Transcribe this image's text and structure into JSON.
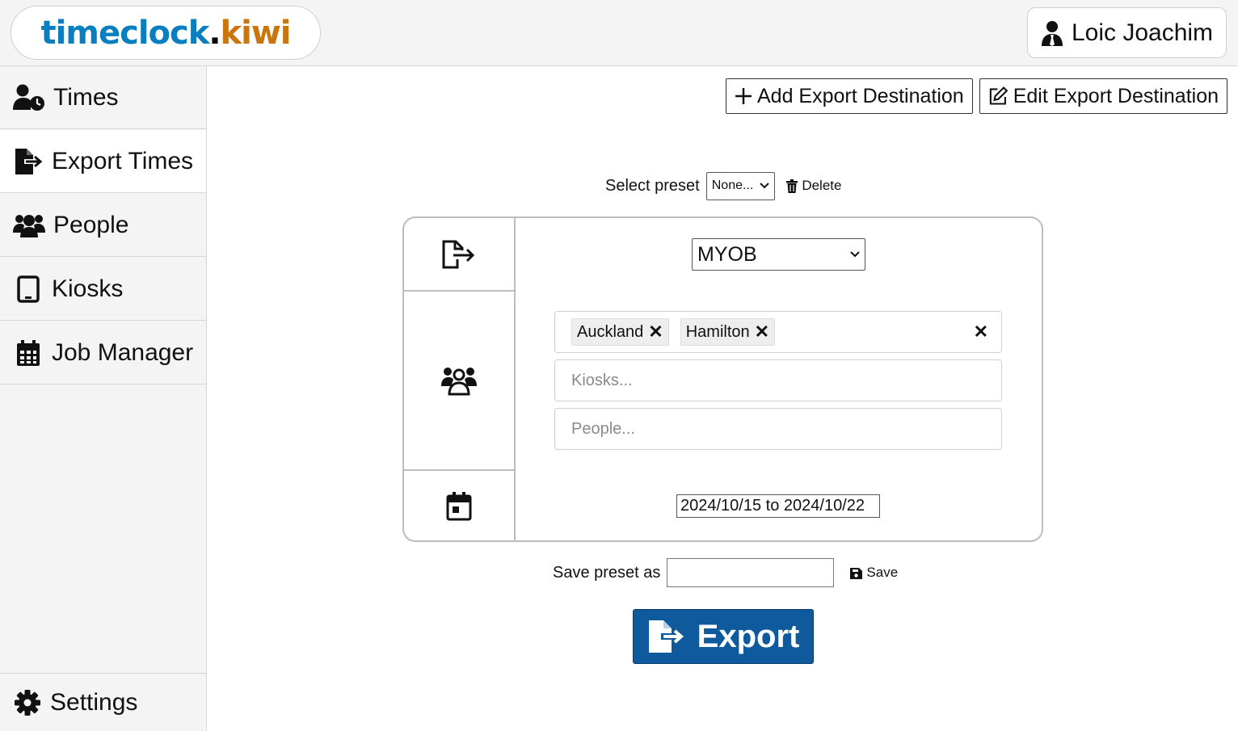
{
  "header": {
    "logo": {
      "part1": "timeclock",
      "part2": ".",
      "part3": "kiwi"
    },
    "user": {
      "name": "Loic Joachim",
      "icon": "user-tie-icon"
    }
  },
  "sidebar": {
    "items": [
      {
        "label": "Times",
        "icon": "user-clock-icon",
        "active": false
      },
      {
        "label": "Export Times",
        "icon": "file-export-icon",
        "active": true
      },
      {
        "label": "People",
        "icon": "users-icon",
        "active": false
      },
      {
        "label": "Kiosks",
        "icon": "tablet-icon",
        "active": false
      },
      {
        "label": "Job Manager",
        "icon": "calendar-icon",
        "active": false
      }
    ],
    "settings": {
      "label": "Settings",
      "icon": "gear-icon"
    }
  },
  "toolbar": {
    "add_label": "Add Export Destination",
    "edit_label": "Edit Export Destination"
  },
  "preset": {
    "label": "Select preset",
    "selected": "None...",
    "delete_label": "Delete"
  },
  "export_form": {
    "destination": "MYOB",
    "groups": [
      "Auckland",
      "Hamilton"
    ],
    "kiosks_placeholder": "Kiosks...",
    "people_placeholder": "People...",
    "date_range": "2024/10/15 to 2024/10/22"
  },
  "save_preset": {
    "label": "Save preset as",
    "value": "",
    "save_label": "Save"
  },
  "export_button": {
    "label": "Export"
  },
  "colors": {
    "brand_blue": "#0a7fc0",
    "brand_orange": "#c9760e",
    "export_button": "#0f5a9c"
  }
}
